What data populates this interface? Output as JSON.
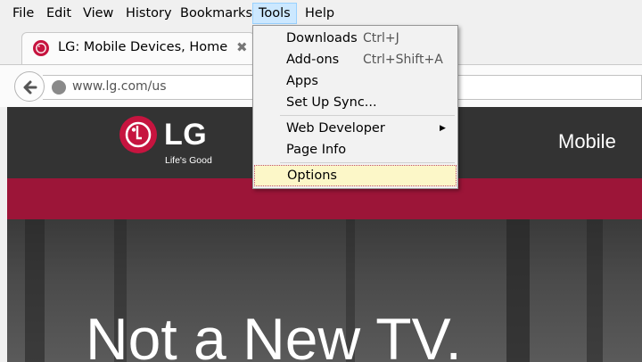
{
  "menubar": {
    "items": [
      "File",
      "Edit",
      "View",
      "History",
      "Bookmarks",
      "Tools",
      "Help"
    ],
    "active": "Tools"
  },
  "tab": {
    "title": "LG: Mobile Devices, Home ...",
    "close_glyph": "✖"
  },
  "navbar": {
    "url": "www.lg.com/us"
  },
  "site": {
    "logo_text": "LG",
    "tagline": "Life's Good",
    "nav_item": "Mobile",
    "headline": "Not a New TV.",
    "brand_color": "#c6143f",
    "band_color": "#9c1538"
  },
  "tools_menu": {
    "items": [
      {
        "label": "Downloads",
        "shortcut": "Ctrl+J"
      },
      {
        "label": "Add-ons",
        "shortcut": "Ctrl+Shift+A"
      },
      {
        "label": "Apps",
        "shortcut": ""
      },
      {
        "label": "Set Up Sync...",
        "shortcut": ""
      },
      {
        "label": "Web Developer",
        "shortcut": "",
        "submenu": true
      },
      {
        "label": "Page Info",
        "shortcut": ""
      },
      {
        "label": "Options",
        "shortcut": "",
        "highlighted": true
      }
    ],
    "submenu_arrow": "▶"
  },
  "icons": {
    "tab_favicon": "lg-logo-icon",
    "back": "back-arrow-icon",
    "site_identity": "globe-icon"
  }
}
